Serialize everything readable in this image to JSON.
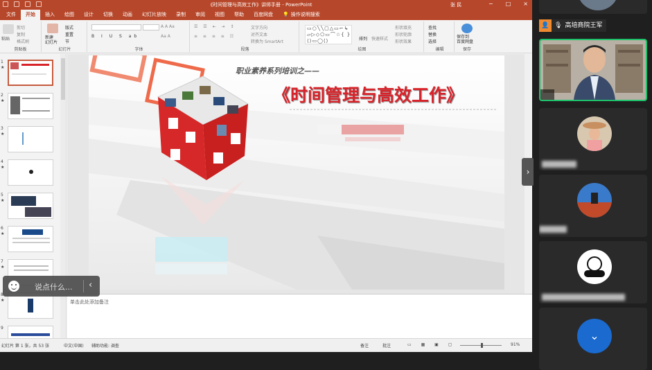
{
  "app": {
    "doc_title": "《时间管理与高效工作》讲师手册 - PowerPoint",
    "user_label": "张 民",
    "window_controls": [
      "−",
      "□",
      "×"
    ]
  },
  "tabs": [
    {
      "label": "文件",
      "active": false
    },
    {
      "label": "开始",
      "active": true
    },
    {
      "label": "插入",
      "active": false
    },
    {
      "label": "绘图",
      "active": false
    },
    {
      "label": "设计",
      "active": false
    },
    {
      "label": "切换",
      "active": false
    },
    {
      "label": "动画",
      "active": false
    },
    {
      "label": "幻灯片放映",
      "active": false
    },
    {
      "label": "录制",
      "active": false
    },
    {
      "label": "审阅",
      "active": false
    },
    {
      "label": "视图",
      "active": false
    },
    {
      "label": "帮助",
      "active": false
    },
    {
      "label": "百度网盘",
      "active": false
    }
  ],
  "help_search": "操作说明搜索",
  "ribbon": {
    "clipboard": {
      "paste": "粘贴",
      "cut": "剪切",
      "copy": "复制",
      "format_painter": "格式刷",
      "label": "剪贴板"
    },
    "slides": {
      "new_slide": "新建\n幻灯片",
      "layout": "版式",
      "reset": "重置",
      "section": "节",
      "label": "幻灯片"
    },
    "font": {
      "label": "字体"
    },
    "paragraph": {
      "text_direction": "文字方向",
      "align_text": "对齐文本",
      "smartart": "转换为 SmartArt",
      "label": "段落"
    },
    "drawing": {
      "arrange": "排列",
      "quick_styles": "快速样式",
      "shape_fill": "形状填充",
      "shape_outline": "形状轮廓",
      "shape_effects": "形状效果",
      "label": "绘图"
    },
    "editing": {
      "find": "查找",
      "replace": "替换",
      "select": "选择",
      "label": "编辑"
    },
    "save": {
      "save_to_baidu": "保存到\n百度网盘",
      "label": "保存"
    }
  },
  "slide_thumbnails": [
    {
      "num": "1",
      "star": "★"
    },
    {
      "num": "2",
      "star": "★"
    },
    {
      "num": "3",
      "star": "★"
    },
    {
      "num": "4",
      "star": "★"
    },
    {
      "num": "5",
      "star": "★"
    },
    {
      "num": "6",
      "star": "★"
    },
    {
      "num": "7",
      "star": "★"
    },
    {
      "num": "8",
      "star": "★"
    },
    {
      "num": "9",
      "star": ""
    }
  ],
  "slide": {
    "subtitle": "职业素养系列培训之——",
    "title": "《时间管理与高效工作》"
  },
  "notes_placeholder": "单击此处添加备注",
  "status": {
    "slide_count": "幻灯片 第 1 张，共 53 张",
    "language": "中文(中国)",
    "accessibility": "辅助功能: 调查",
    "notes": "备注",
    "comments": "批注",
    "zoom": "91%"
  },
  "chat": {
    "placeholder": "说点什么..."
  },
  "participants": [
    {
      "name": "",
      "active": false,
      "muted": false
    },
    {
      "name": "高培商院王军",
      "active": false,
      "muted": false
    },
    {
      "name": "",
      "active": true,
      "muted": false
    },
    {
      "name": "",
      "active": false,
      "muted": true
    },
    {
      "name": "",
      "active": false,
      "muted": true
    },
    {
      "name": "",
      "active": false,
      "muted": true
    }
  ],
  "colors": {
    "ppt_red": "#b7472a",
    "title_red": "#d8232a",
    "speaker_green": "#1ec26a"
  }
}
